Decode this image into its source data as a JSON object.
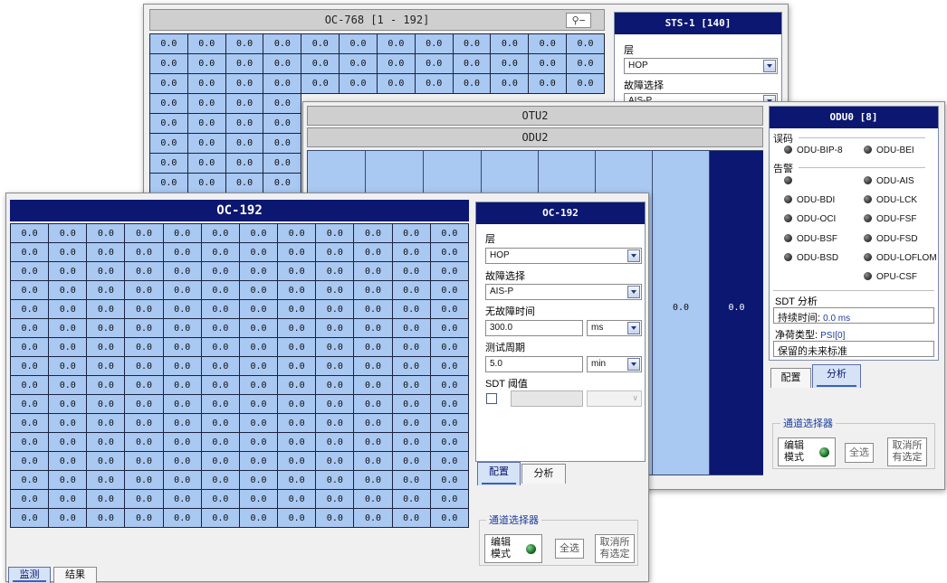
{
  "oc768_window": {
    "title": "OC-768 [1 - 192]",
    "zoom_icon": "zoom-out-icon",
    "rows": [
      [
        "0.0",
        "0.0",
        "0.0",
        "0.0",
        "0.0",
        "0.0",
        "0.0",
        "0.0",
        "0.0",
        "0.0",
        "0.0",
        "0.0"
      ],
      [
        "0.0",
        "0.0",
        "0.0",
        "0.0",
        "0.0",
        "0.0",
        "0.0",
        "0.0",
        "0.0",
        "0.0",
        "0.0",
        "0.0"
      ],
      [
        "0.0",
        "0.0",
        "0.0",
        "0.0",
        "0.0",
        "0.0",
        "0.0",
        "0.0",
        "0.0",
        "0.0",
        "0.0",
        "0.0"
      ],
      [
        "0.0",
        "0.0",
        "0.0",
        "0.0"
      ],
      [
        "0.0",
        "0.0",
        "0.0",
        "0.0"
      ],
      [
        "0.0",
        "0.0",
        "0.0",
        "0.0"
      ],
      [
        "0.0",
        "0.0",
        "0.0",
        "0.0"
      ],
      [
        "0.0",
        "0.0",
        "0.0",
        "0.0"
      ]
    ],
    "side_panel": {
      "title": "STS-1 [140]",
      "layer_label": "层",
      "layer_value": "HOP",
      "fault_label": "故障选择",
      "fault_value": "AIS-P"
    }
  },
  "otu2_window": {
    "otu_title": "OTU2",
    "odu_title": "ODU2",
    "cells": [
      "0.0",
      "0.0"
    ],
    "odu_panel": {
      "title": "ODU0 [8]",
      "error_group": "误码",
      "errors": [
        "ODU-BIP-8",
        "ODU-BEI"
      ],
      "alarm_group": "告警",
      "alarms": [
        "ODU-AIS",
        "ODU-BDI",
        "ODU-LCK",
        "ODU-OCI",
        "ODU-FSF",
        "ODU-BSF",
        "ODU-FSD",
        "ODU-BSD",
        "ODU-LOFLOM",
        "OPU-CSF"
      ],
      "sdt_label": "SDT 分析",
      "duration_label": "持续时间:",
      "duration_value": "0.0 ms",
      "payload_label": "净荷类型:",
      "payload_value": "PSI[0]",
      "payload_desc": "保留的未来标准"
    },
    "tabs": [
      "配置",
      "分析"
    ],
    "channel_selector": {
      "legend": "通道选择器",
      "edit_mode": "编辑\n模式",
      "select_all": "全选",
      "deselect_all": "取消所\n有选定"
    }
  },
  "oc192_window": {
    "title": "OC-192",
    "rows": [
      [
        "0.0",
        "0.0",
        "0.0",
        "0.0",
        "0.0",
        "0.0",
        "0.0",
        "0.0",
        "0.0",
        "0.0",
        "0.0",
        "0.0"
      ],
      [
        "0.0",
        "0.0",
        "0.0",
        "0.0",
        "0.0",
        "0.0",
        "0.0",
        "0.0",
        "0.0",
        "0.0",
        "0.0",
        "0.0"
      ],
      [
        "0.0",
        "0.0",
        "0.0",
        "0.0",
        "0.0",
        "0.0",
        "0.0",
        "0.0",
        "0.0",
        "0.0",
        "0.0",
        "0.0"
      ],
      [
        "0.0",
        "0.0",
        "0.0",
        "0.0",
        "0.0",
        "0.0",
        "0.0",
        "0.0",
        "0.0",
        "0.0",
        "0.0",
        "0.0"
      ],
      [
        "0.0",
        "0.0",
        "0.0",
        "0.0",
        "0.0",
        "0.0",
        "0.0",
        "0.0",
        "0.0",
        "0.0",
        "0.0",
        "0.0"
      ],
      [
        "0.0",
        "0.0",
        "0.0",
        "0.0",
        "0.0",
        "0.0",
        "0.0",
        "0.0",
        "0.0",
        "0.0",
        "0.0",
        "0.0"
      ],
      [
        "0.0",
        "0.0",
        "0.0",
        "0.0",
        "0.0",
        "0.0",
        "0.0",
        "0.0",
        "0.0",
        "0.0",
        "0.0",
        "0.0"
      ],
      [
        "0.0",
        "0.0",
        "0.0",
        "0.0",
        "0.0",
        "0.0",
        "0.0",
        "0.0",
        "0.0",
        "0.0",
        "0.0",
        "0.0"
      ],
      [
        "0.0",
        "0.0",
        "0.0",
        "0.0",
        "0.0",
        "0.0",
        "0.0",
        "0.0",
        "0.0",
        "0.0",
        "0.0",
        "0.0"
      ],
      [
        "0.0",
        "0.0",
        "0.0",
        "0.0",
        "0.0",
        "0.0",
        "0.0",
        "0.0",
        "0.0",
        "0.0",
        "0.0",
        "0.0"
      ],
      [
        "0.0",
        "0.0",
        "0.0",
        "0.0",
        "0.0",
        "0.0",
        "0.0",
        "0.0",
        "0.0",
        "0.0",
        "0.0",
        "0.0"
      ],
      [
        "0.0",
        "0.0",
        "0.0",
        "0.0",
        "0.0",
        "0.0",
        "0.0",
        "0.0",
        "0.0",
        "0.0",
        "0.0",
        "0.0"
      ],
      [
        "0.0",
        "0.0",
        "0.0",
        "0.0",
        "0.0",
        "0.0",
        "0.0",
        "0.0",
        "0.0",
        "0.0",
        "0.0",
        "0.0"
      ],
      [
        "0.0",
        "0.0",
        "0.0",
        "0.0",
        "0.0",
        "0.0",
        "0.0",
        "0.0",
        "0.0",
        "0.0",
        "0.0",
        "0.0"
      ],
      [
        "0.0",
        "0.0",
        "0.0",
        "0.0",
        "0.0",
        "0.0",
        "0.0",
        "0.0",
        "0.0",
        "0.0",
        "0.0",
        "0.0"
      ],
      [
        "0.0",
        "0.0",
        "0.0",
        "0.0",
        "0.0",
        "0.0",
        "0.0",
        "0.0",
        "0.0",
        "0.0",
        "0.0",
        "0.0"
      ]
    ],
    "side_panel": {
      "title": "OC-192",
      "layer_label": "层",
      "layer_value": "HOP",
      "fault_label": "故障选择",
      "fault_value": "AIS-P",
      "errorfree_label": "无故障时间",
      "errorfree_value": "300.0",
      "errorfree_unit": "ms",
      "period_label": "测试周期",
      "period_value": "5.0",
      "period_unit": "min",
      "sdt_label": "SDT 阈值"
    },
    "tabs": [
      "配置",
      "分析"
    ],
    "channel_selector": {
      "legend": "通道选择器",
      "edit_mode": "编辑\n模式",
      "select_all": "全选",
      "deselect_all": "取消所\n有选定"
    },
    "bottom_tabs": [
      "监测",
      "结果"
    ]
  },
  "colors": {
    "cell": "#a9c8f2",
    "navy": "#0b1770",
    "accent": "#1a3c9c"
  }
}
